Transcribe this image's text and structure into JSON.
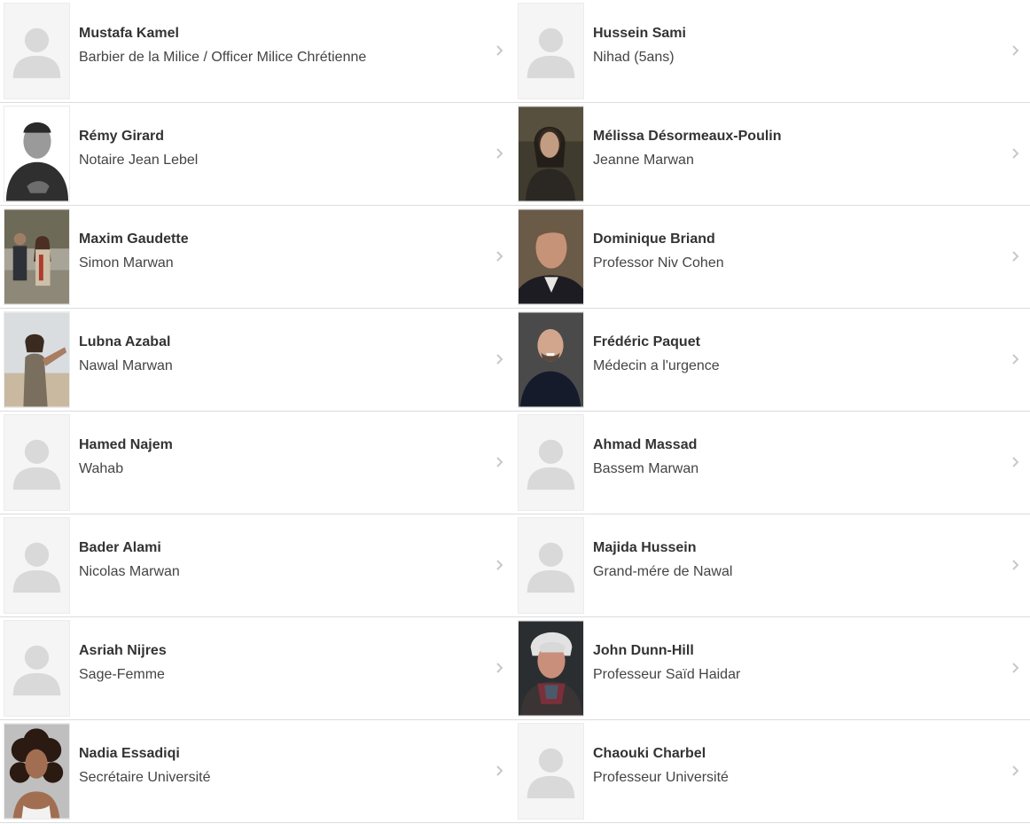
{
  "cast": [
    {
      "name": "Mustafa Kamel",
      "role": "Barbier de la Milice / Officer Milice Chrétienne",
      "photo": "placeholder-avatar-icon"
    },
    {
      "name": "Hussein Sami",
      "role": "Nihad (5ans)",
      "photo": "placeholder-avatar-icon"
    },
    {
      "name": "Rémy Girard",
      "role": "Notaire Jean Lebel",
      "photo": "photo-bw-man-dark-jacket"
    },
    {
      "name": "Mélissa Désormeaux-Poulin",
      "role": "Jeanne Marwan",
      "photo": "photo-dark-haired-woman"
    },
    {
      "name": "Maxim Gaudette",
      "role": "Simon Marwan",
      "photo": "photo-couple-on-beach"
    },
    {
      "name": "Dominique Briand",
      "role": "Professor Niv Cohen",
      "photo": "photo-man-in-suit"
    },
    {
      "name": "Lubna Azabal",
      "role": "Nawal Marwan",
      "photo": "photo-woman-outdoors"
    },
    {
      "name": "Frédéric Paquet",
      "role": "Médecin a l'urgence",
      "photo": "photo-bald-smiling-man"
    },
    {
      "name": "Hamed Najem",
      "role": "Wahab",
      "photo": "placeholder-avatar-icon"
    },
    {
      "name": "Ahmad Massad",
      "role": "Bassem Marwan",
      "photo": "placeholder-avatar-icon"
    },
    {
      "name": "Bader Alami",
      "role": "Nicolas Marwan",
      "photo": "placeholder-avatar-icon"
    },
    {
      "name": "Majida Hussein",
      "role": "Grand-mére de Nawal",
      "photo": "placeholder-avatar-icon"
    },
    {
      "name": "Asriah Nijres",
      "role": "Sage-Femme",
      "photo": "placeholder-avatar-icon"
    },
    {
      "name": "John Dunn-Hill",
      "role": "Professeur Saïd Haidar",
      "photo": "photo-elderly-man-scarf"
    },
    {
      "name": "Nadia Essadiqi",
      "role": "Secrétaire Université",
      "photo": "photo-curly-haired-woman"
    },
    {
      "name": "Chaouki Charbel",
      "role": "Professeur Université",
      "photo": "placeholder-avatar-icon"
    }
  ],
  "colors": {
    "name_text": "#333333",
    "role_text": "#444444",
    "divider": "#dcdcdc",
    "chevron": "#c8c8c8",
    "placeholder": "#d9d9d9"
  }
}
